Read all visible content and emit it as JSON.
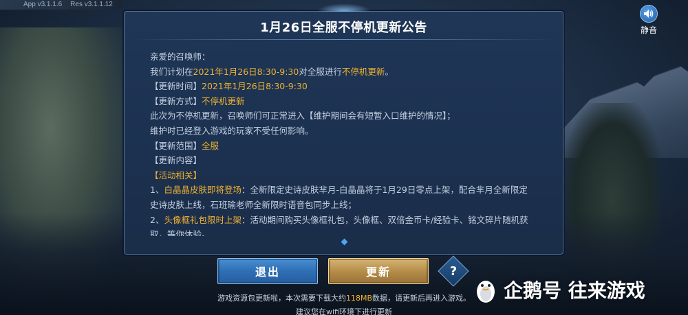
{
  "version": {
    "app": "App v3.1.1.6",
    "res": "Res v3.1.1.12"
  },
  "mute": {
    "label": "静音",
    "icon": "speaker-icon"
  },
  "dialog": {
    "title": "1月26日全服不停机更新公告",
    "lines": [
      [
        {
          "t": "亲爱的召唤师：",
          "c": ""
        }
      ],
      [
        {
          "t": "我们计划在",
          "c": ""
        },
        {
          "t": "2021年1月26日8:30-9:30",
          "c": "hl"
        },
        {
          "t": "对全服进行",
          "c": ""
        },
        {
          "t": "不停机更新",
          "c": "hl"
        },
        {
          "t": "。",
          "c": ""
        }
      ],
      [
        {
          "t": "【更新时间】",
          "c": ""
        },
        {
          "t": "2021年1月26日8:30-9:30",
          "c": "hl"
        }
      ],
      [
        {
          "t": "【更新方式】",
          "c": ""
        },
        {
          "t": "不停机更新",
          "c": "hl"
        }
      ],
      [
        {
          "t": "此次为不停机更新，召唤师们可正常进入【维护期间会有短暂入口维护的情况】；",
          "c": ""
        }
      ],
      [
        {
          "t": "维护时已经登入游戏的玩家不受任何影响。",
          "c": ""
        }
      ],
      [
        {
          "t": "【更新范围】",
          "c": ""
        },
        {
          "t": "全服",
          "c": "hl"
        }
      ],
      [
        {
          "t": "【更新内容】",
          "c": ""
        }
      ],
      [
        {
          "t": "【活动相关】",
          "c": "hl"
        }
      ],
      [
        {
          "t": "1、",
          "c": ""
        },
        {
          "t": "白晶晶皮肤即将登场",
          "c": "hl"
        },
        {
          "t": "：全新限定史诗皮肤芈月-白晶晶将于1月29日零点上架，配合芈月全新限定史诗皮肤上线，石班瑜老师全新限时语音包同步上线；",
          "c": ""
        }
      ],
      [
        {
          "t": "2、",
          "c": ""
        },
        {
          "t": "头像框礼包限时上架",
          "c": "hl"
        },
        {
          "t": "：活动期间购买头像框礼包，头像框、双倍金币卡/经验卡、铭文碎片随机获取，等你体验。",
          "c": ""
        }
      ]
    ]
  },
  "buttons": {
    "exit": "退出",
    "update": "更新",
    "help": "?"
  },
  "footer": {
    "note_prefix": "游戏资源包更新啦，本次需要下载大约",
    "note_size": "118MB",
    "note_suffix": "数据，请更新后再进入游戏。",
    "note2": "建议您在wifi环境下进行更新"
  },
  "watermark": {
    "text": "企鹅号 往来游戏",
    "icon": "penguin-icon"
  },
  "colors": {
    "accent": "#f0b230",
    "dialog_bg": "#1f3656",
    "exit_btn": "#2f6fb5",
    "update_btn": "#b28a46"
  }
}
